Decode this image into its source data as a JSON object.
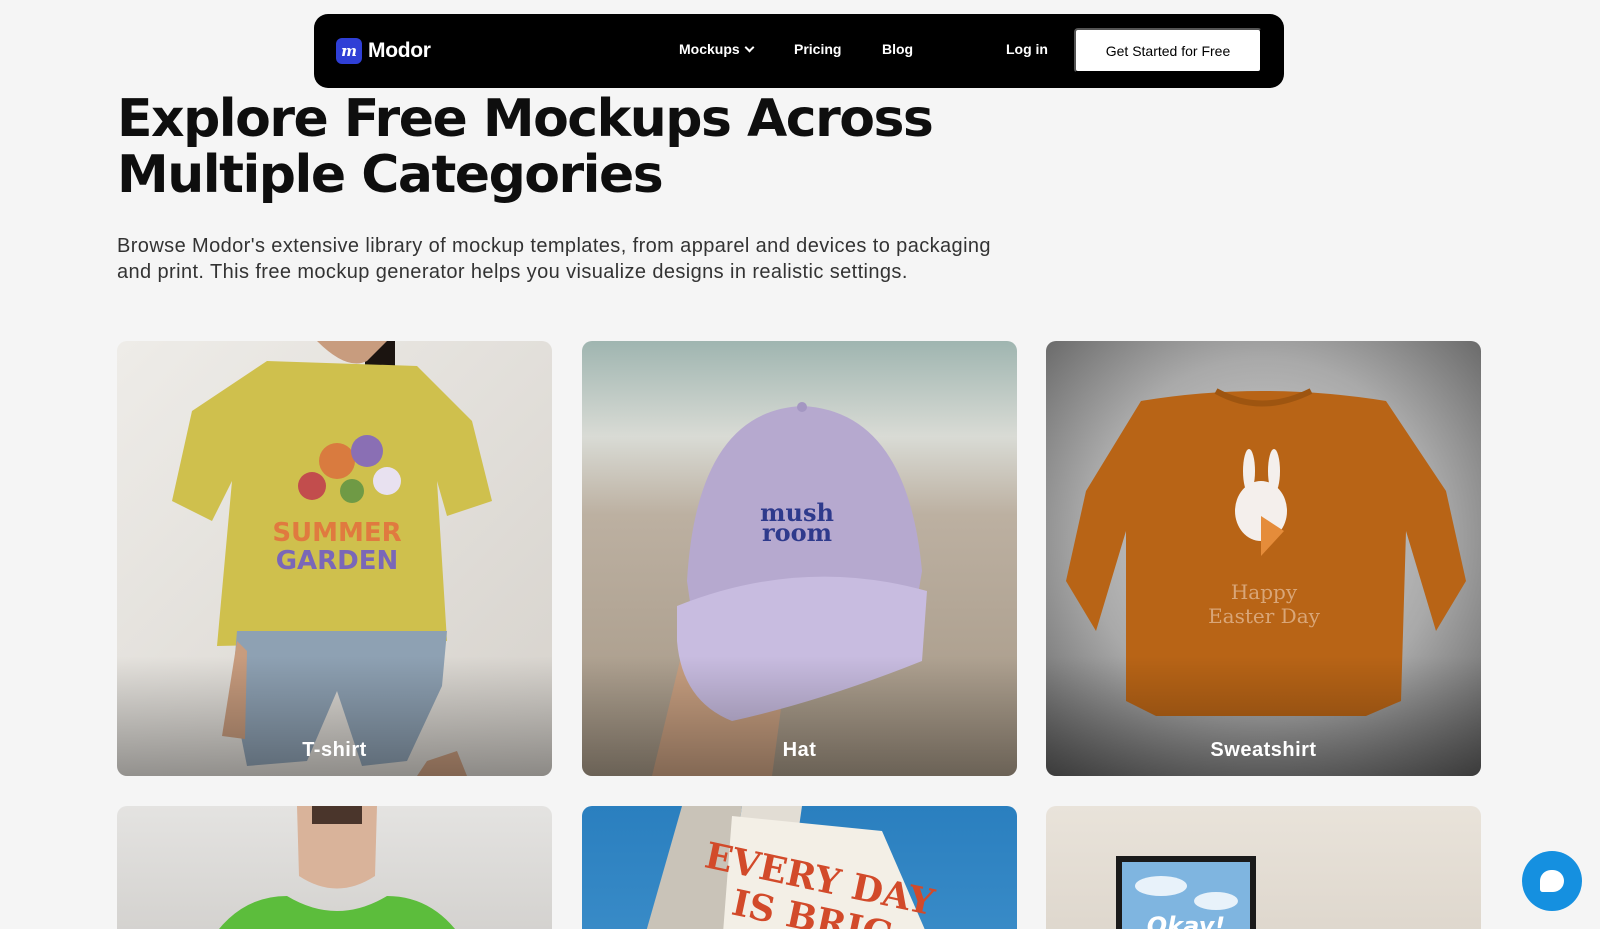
{
  "nav": {
    "logo_text": "Modor",
    "logo_mark": "m",
    "links": {
      "mockups": "Mockups",
      "pricing": "Pricing",
      "blog": "Blog",
      "login": "Log in"
    },
    "cta": "Get Started for Free"
  },
  "hero": {
    "title": "Explore Free Mockups Across Multiple Categories",
    "description": "Browse Modor's extensive library of mockup templates, from apparel and devices to packaging and print. This free mockup generator helps you visualize designs in realistic settings."
  },
  "categories": [
    {
      "label": "T-shirt",
      "artwork_text": [
        "SUMMER",
        "GARDEN"
      ]
    },
    {
      "label": "Hat",
      "artwork_text": [
        "mush",
        "room"
      ]
    },
    {
      "label": "Sweatshirt",
      "artwork_text": [
        "Happy",
        "Easter Day"
      ]
    },
    {
      "label": ""
    },
    {
      "label": "",
      "artwork_text": [
        "EVERY DAY",
        "IS BRIG"
      ]
    },
    {
      "label": "",
      "artwork_text": [
        "Okay!"
      ]
    }
  ],
  "chat": {
    "icon": "chat-bubble-icon"
  },
  "colors": {
    "nav_bg": "#000000",
    "page_bg": "#f5f5f5",
    "chat": "#1590e0",
    "logo": "#2f3fd6"
  }
}
